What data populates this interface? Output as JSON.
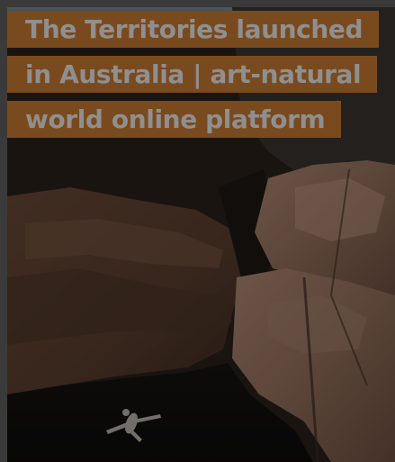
{
  "article": {
    "headline": "The Territories launched in Australia | art-natural world online platform",
    "image_description_icon": "photo-image"
  },
  "colors": {
    "headline_bg": "#7a4a1f",
    "headline_text": "#8f8f8f",
    "page_bg": "#3a3a3a"
  }
}
